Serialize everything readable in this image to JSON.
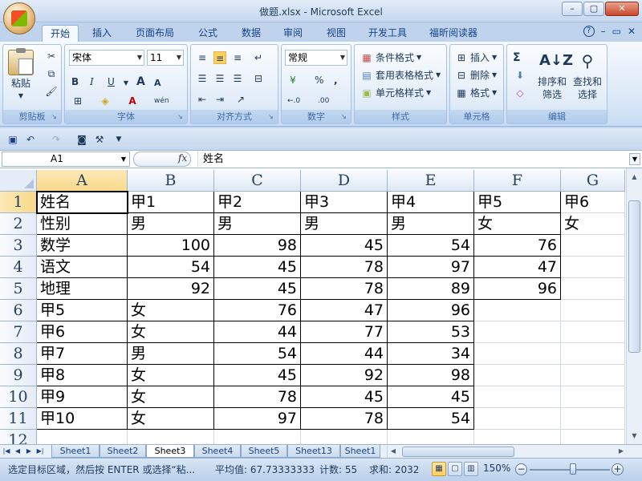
{
  "window": {
    "title": "做题.xlsx - Microsoft Excel",
    "minimize": "–",
    "restore": "▢",
    "close": "✕"
  },
  "tabs": [
    "开始",
    "插入",
    "页面布局",
    "公式",
    "数据",
    "审阅",
    "视图",
    "开发工具",
    "福昕阅读器"
  ],
  "active_tab": "开始",
  "help_icons": [
    "?",
    "–",
    "▭",
    "✕"
  ],
  "ribbon": {
    "clipboard": {
      "label": "剪贴板",
      "paste": "粘贴"
    },
    "font": {
      "label": "字体",
      "font_name": "宋体",
      "font_size": "11",
      "bold": "B",
      "italic": "I",
      "underline": "U",
      "grow": "A",
      "shrink": "A",
      "phonetic": "wén"
    },
    "alignment": {
      "label": "对齐方式"
    },
    "number": {
      "label": "数字",
      "format": "常规",
      "percent": "%",
      "comma": ",",
      "inc_decimal": "←.0",
      "dec_decimal": ".00"
    },
    "styles": {
      "label": "样式",
      "conditional": "条件格式",
      "table": "套用表格格式",
      "cell_styles": "单元格样式"
    },
    "cells": {
      "label": "单元格",
      "insert": "插入",
      "delete": "删除",
      "format": "格式"
    },
    "editing": {
      "label": "编辑",
      "sigma": "Σ",
      "sort": "排序和",
      "sort2": "筛选",
      "find": "查找和",
      "find2": "选择"
    }
  },
  "formula_bar": {
    "name_box": "A1",
    "fx": "fx",
    "content": "姓名"
  },
  "columns": [
    "A",
    "B",
    "C",
    "D",
    "E",
    "F",
    "G"
  ],
  "rows": [
    {
      "n": "1",
      "cells": [
        "姓名",
        "甲1",
        "甲2",
        "甲3",
        "甲4",
        "甲5",
        "甲6"
      ]
    },
    {
      "n": "2",
      "cells": [
        "性别",
        "男",
        "男",
        "男",
        "男",
        "女",
        "女"
      ]
    },
    {
      "n": "3",
      "cells": [
        "数学",
        "100",
        "98",
        "45",
        "54",
        "76",
        ""
      ]
    },
    {
      "n": "4",
      "cells": [
        "语文",
        "54",
        "45",
        "78",
        "97",
        "47",
        ""
      ]
    },
    {
      "n": "5",
      "cells": [
        "地理",
        "92",
        "45",
        "78",
        "89",
        "96",
        ""
      ]
    },
    {
      "n": "6",
      "cells": [
        "甲5",
        "女",
        "76",
        "47",
        "96",
        "",
        ""
      ]
    },
    {
      "n": "7",
      "cells": [
        "甲6",
        "女",
        "44",
        "77",
        "53",
        "",
        ""
      ]
    },
    {
      "n": "8",
      "cells": [
        "甲7",
        "男",
        "54",
        "44",
        "34",
        "",
        ""
      ]
    },
    {
      "n": "9",
      "cells": [
        "甲8",
        "女",
        "45",
        "92",
        "98",
        "",
        ""
      ]
    },
    {
      "n": "10",
      "cells": [
        "甲9",
        "女",
        "78",
        "45",
        "45",
        "",
        ""
      ]
    },
    {
      "n": "11",
      "cells": [
        "甲10",
        "女",
        "97",
        "78",
        "54",
        "",
        ""
      ]
    },
    {
      "n": "12",
      "cells": [
        "",
        "",
        "",
        "",
        "",
        "",
        ""
      ]
    }
  ],
  "sheets": [
    "Sheet1",
    "Sheet2",
    "Sheet3",
    "Sheet4",
    "Sheet5",
    "Sheet13",
    "Sheet1"
  ],
  "active_sheet": "Sheet3",
  "status": {
    "message": "选定目标区域，然后按 ENTER 或选择“粘...",
    "average": "平均值: 67.73333333",
    "count": "计数: 55",
    "sum": "求和: 2032",
    "zoom": "150%"
  },
  "colors": {
    "accent": "#15428b",
    "ribbon_bg": "#dbe8f7",
    "border": "#9eb6ce"
  }
}
